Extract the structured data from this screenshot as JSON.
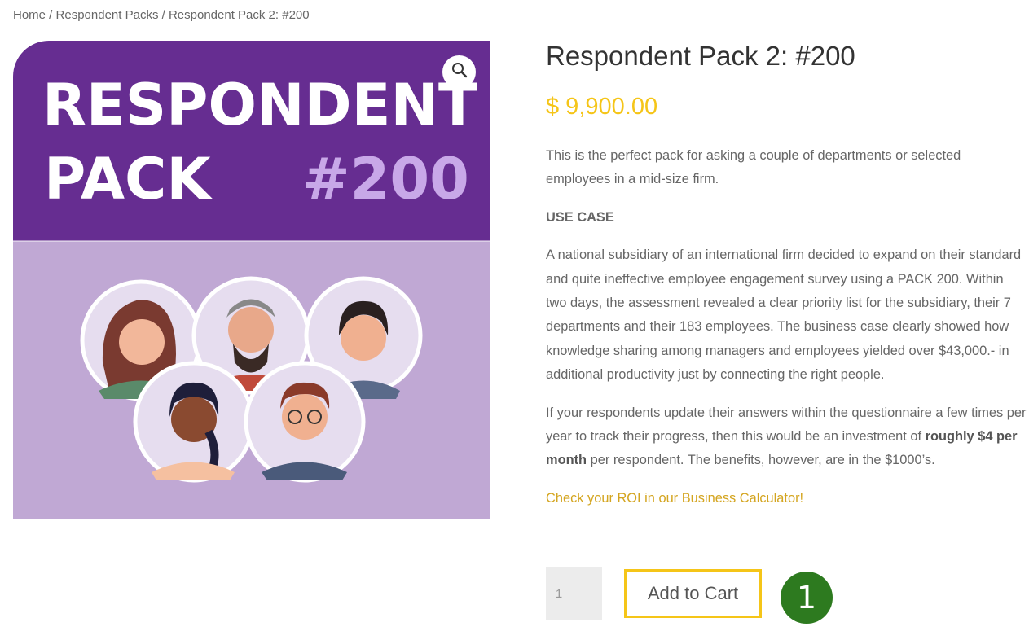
{
  "breadcrumb": {
    "home": "Home",
    "category": "Respondent Packs",
    "current": "Respondent Pack 2: #200",
    "separator": " / "
  },
  "image": {
    "banner_line1": "RESPONDENT",
    "banner_line2": "PACK",
    "banner_number": "#200",
    "zoom_icon": "magnifier-icon"
  },
  "product": {
    "title": "Respondent Pack 2: #200",
    "price": "$ 9,900.00",
    "intro": "This is the perfect pack for asking a couple of departments or selected employees in a mid-size firm.",
    "use_case_heading": "USE CASE",
    "use_case_text": "A national subsidiary of an international firm decided to expand on their standard and quite ineffective employee engagement survey using a PACK 200. Within two days, the assessment revealed a clear priority list for the subsidiary, their 7 departments and their 183 employees. The business case clearly showed how knowledge sharing among managers and employees yielded over $43,000.- in additional productivity just by connecting the right people.",
    "investment_text_before": "If your respondents update their answers within the questionnaire a few times per year to track their progress, then this would be an investment of ",
    "investment_bold": "roughly $4 per month",
    "investment_text_after": " per respondent. The benefits, however, are in the $1000’s.",
    "roi_link": "Check your ROI in our Business Calculator!"
  },
  "cart": {
    "quantity": "1",
    "add_label": "Add to Cart"
  },
  "annotation": {
    "step_number": "1"
  },
  "colors": {
    "accent": "#f5c518",
    "link": "#d4a520",
    "banner_purple": "#662d91",
    "lower_purple": "#c0a8d4",
    "badge_green": "#2d7a1f"
  }
}
